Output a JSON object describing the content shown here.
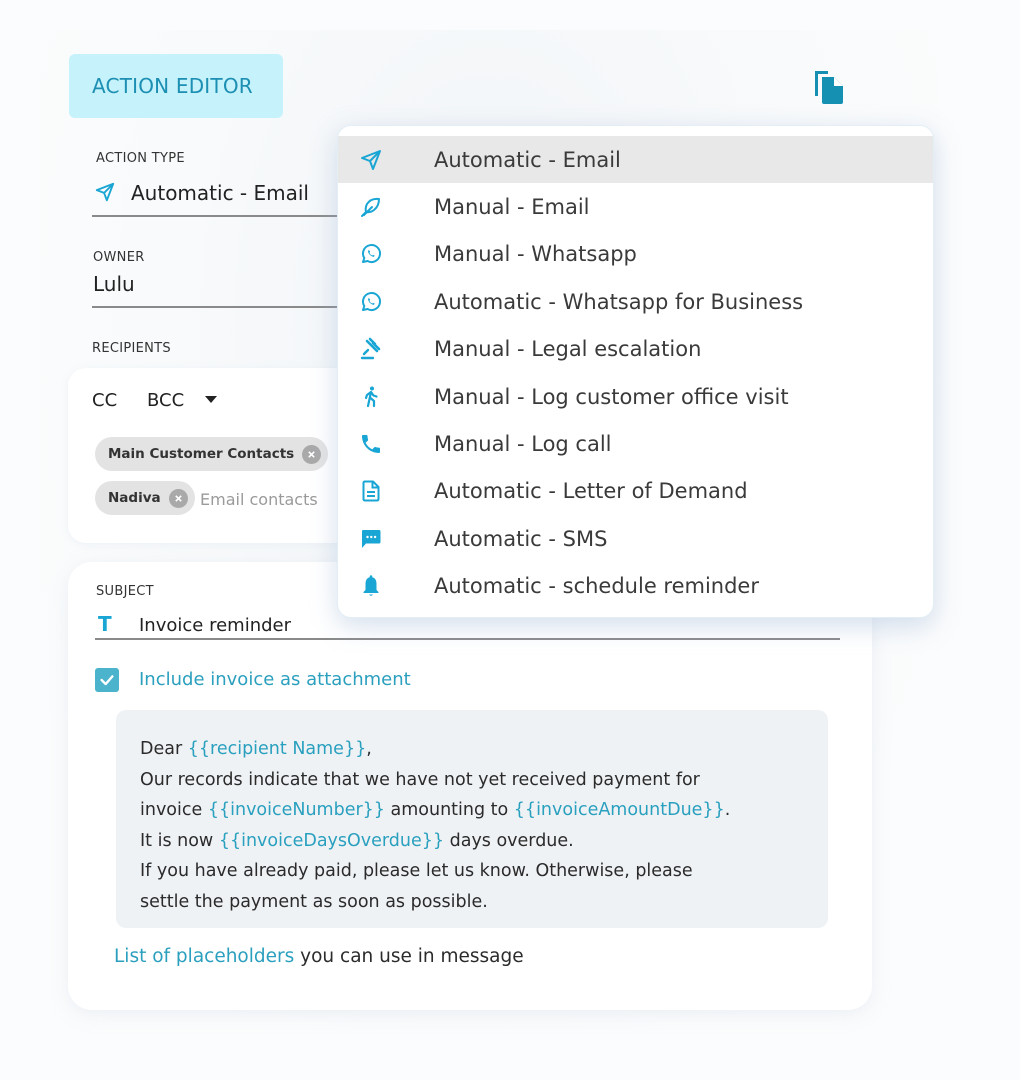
{
  "header": {
    "title": "ACTION EDITOR",
    "copy_icon": "copy-document-icon"
  },
  "colors": {
    "accent": "#2aa0bf",
    "header_bg": "#c5f2fb",
    "icon": "#19a6d4",
    "selected_bg": "#e8e8e8",
    "message_bg": "#eff2f5"
  },
  "action_type": {
    "label": "ACTION TYPE",
    "value": "Automatic - Email",
    "icon": "send-icon"
  },
  "owner": {
    "label": "OWNER",
    "value": "Lulu"
  },
  "recipients": {
    "label": "RECIPIENTS",
    "cc": "CC",
    "bcc": "BCC",
    "chips": [
      {
        "label": "Main Customer Contacts"
      },
      {
        "label": "Nadiva"
      }
    ],
    "input_placeholder": "Email contacts"
  },
  "subject": {
    "label": "SUBJECT",
    "icon": "text-format-icon",
    "value": "Invoice reminder"
  },
  "attachment": {
    "checked": true,
    "label": "Include invoice as attachment"
  },
  "message": {
    "line1_pre": "Dear ",
    "line1_ph": "{{recipient Name}}",
    "line1_post": ",",
    "line2": "Our records indicate that we have not yet received payment for",
    "line3_pre": "invoice ",
    "line3_ph1": "{{invoiceNumber}}",
    "line3_mid": " amounting to ",
    "line3_ph2": "{{invoiceAmountDue}}",
    "line3_post": ".",
    "line4_pre": "It is now ",
    "line4_ph": "{{invoiceDaysOverdue}}",
    "line4_post": " days overdue.",
    "line5": "If you have already paid, please let us know. Otherwise, please",
    "line6": "settle the payment as soon as possible."
  },
  "footer": {
    "link": "List of placeholders",
    "text": " you can use in message"
  },
  "dropdown": {
    "selected_index": 0,
    "items": [
      {
        "label": "Automatic - Email",
        "icon": "send-icon"
      },
      {
        "label": "Manual - Email",
        "icon": "feather-icon"
      },
      {
        "label": "Manual - Whatsapp",
        "icon": "whatsapp-icon"
      },
      {
        "label": "Automatic - Whatsapp for Business",
        "icon": "whatsapp-icon"
      },
      {
        "label": "Manual - Legal escalation",
        "icon": "gavel-icon"
      },
      {
        "label": "Manual - Log customer office visit",
        "icon": "walking-person-icon"
      },
      {
        "label": "Manual - Log call",
        "icon": "phone-icon"
      },
      {
        "label": "Automatic - Letter of Demand",
        "icon": "document-icon"
      },
      {
        "label": "Automatic - SMS",
        "icon": "chat-bubble-icon"
      },
      {
        "label": "Automatic - schedule reminder",
        "icon": "bell-icon"
      }
    ]
  }
}
